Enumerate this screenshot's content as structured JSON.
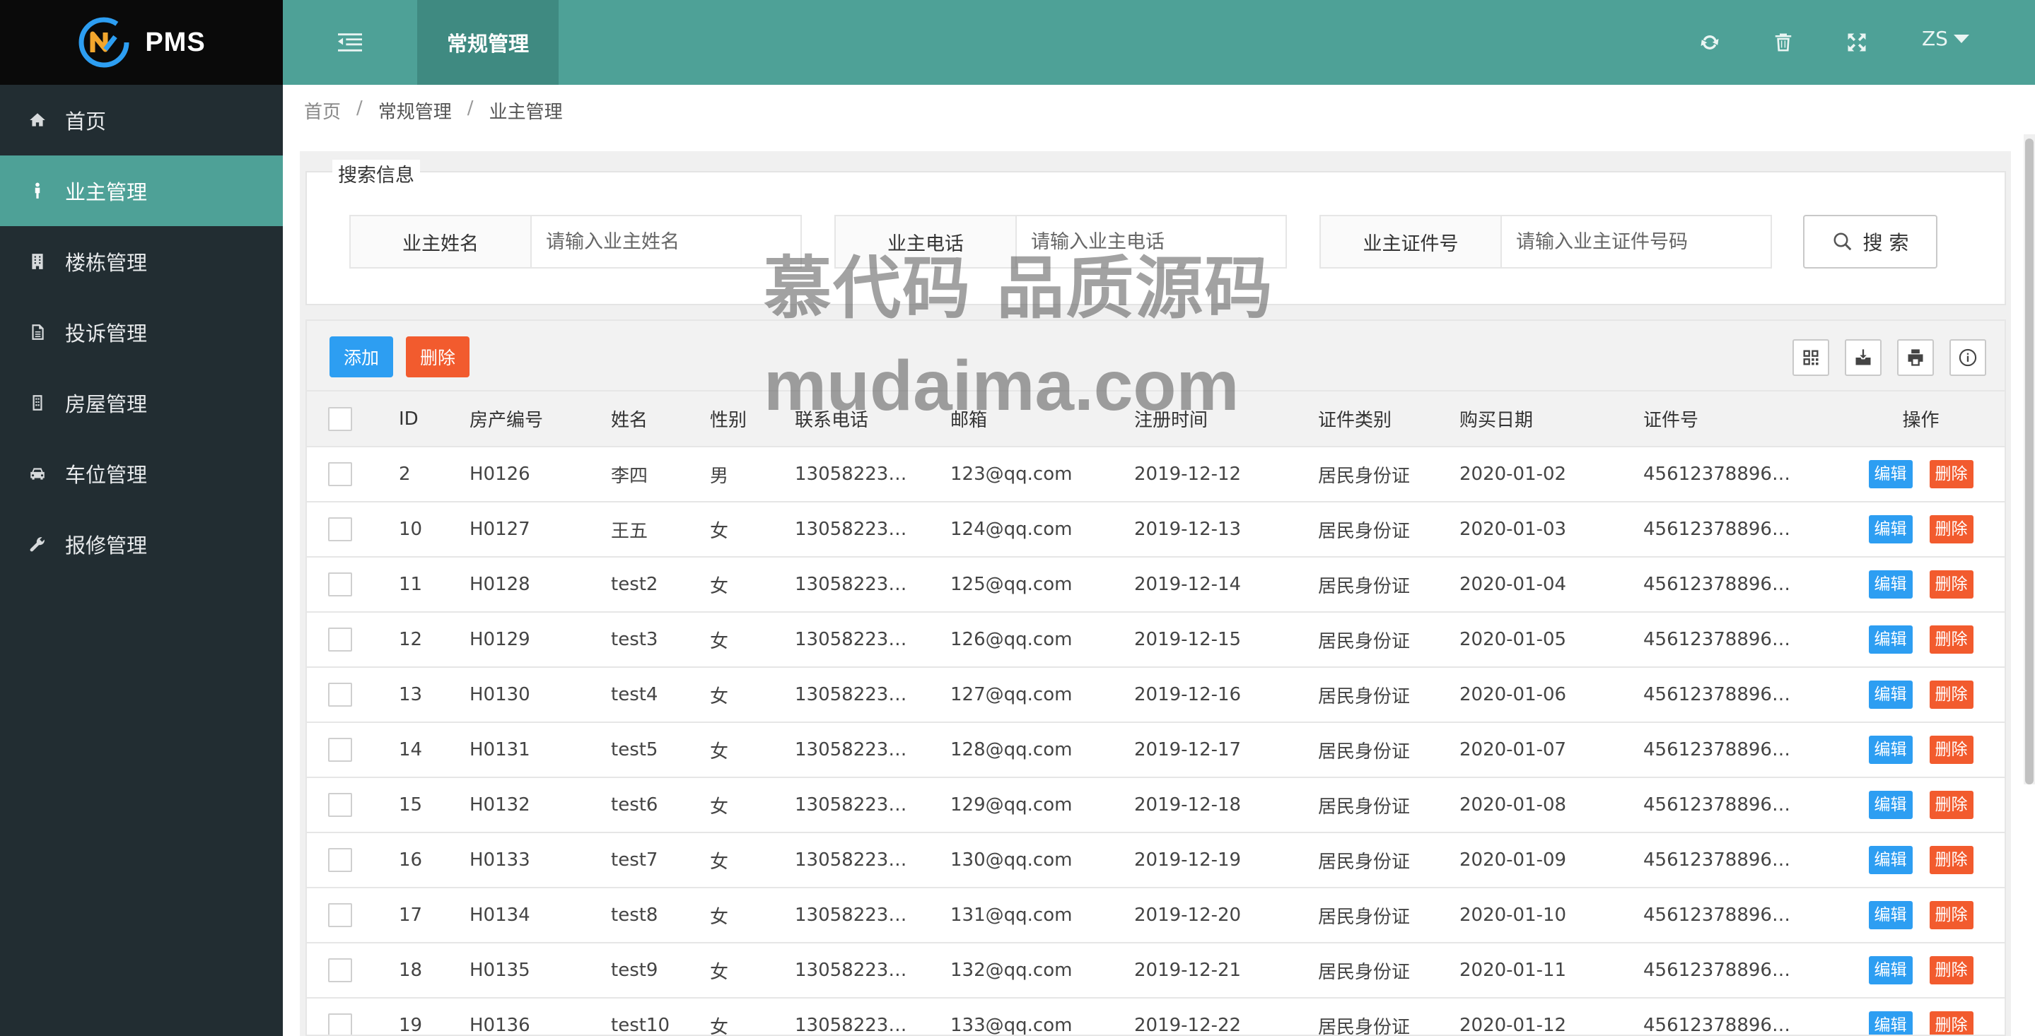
{
  "brand": {
    "name": "PMS"
  },
  "sidebar": {
    "items": [
      {
        "label": "首页",
        "icon": "home-icon"
      },
      {
        "label": "业主管理",
        "icon": "person-icon",
        "active": true
      },
      {
        "label": "楼栋管理",
        "icon": "building-icon"
      },
      {
        "label": "投诉管理",
        "icon": "document-icon"
      },
      {
        "label": "房屋管理",
        "icon": "house-icon"
      },
      {
        "label": "车位管理",
        "icon": "car-icon"
      },
      {
        "label": "报修管理",
        "icon": "wrench-icon"
      }
    ]
  },
  "header": {
    "tab": "常规管理",
    "user": "ZS",
    "icons": [
      "refresh-icon",
      "trash-icon",
      "fullscreen-icon",
      "more-icon"
    ]
  },
  "breadcrumb": {
    "home": "首页",
    "section": "常规管理",
    "page": "业主管理"
  },
  "search": {
    "legend": "搜索信息",
    "fields": [
      {
        "label": "业主姓名",
        "placeholder": "请输入业主姓名"
      },
      {
        "label": "业主电话",
        "placeholder": "请输入业主电话"
      },
      {
        "label": "业主证件号",
        "placeholder": "请输入业主证件号码"
      }
    ],
    "button": "搜 索"
  },
  "toolbar": {
    "add": "添加",
    "delete": "删除"
  },
  "table": {
    "columns": [
      "ID",
      "房产编号",
      "姓名",
      "性别",
      "联系电话",
      "邮箱",
      "注册时间",
      "证件类别",
      "购买日期",
      "证件号",
      "操作"
    ],
    "edit_label": "编辑",
    "delete_label": "删除",
    "rows": [
      {
        "id": "2",
        "house": "H0126",
        "name": "李四",
        "gender": "男",
        "phone": "13058223…",
        "email": "123@qq.com",
        "reg": "2019-12-12",
        "idtype": "居民身份证",
        "buy": "2020-01-02",
        "idno": "45612378896…"
      },
      {
        "id": "10",
        "house": "H0127",
        "name": "王五",
        "gender": "女",
        "phone": "13058223…",
        "email": "124@qq.com",
        "reg": "2019-12-13",
        "idtype": "居民身份证",
        "buy": "2020-01-03",
        "idno": "45612378896…"
      },
      {
        "id": "11",
        "house": "H0128",
        "name": "test2",
        "gender": "女",
        "phone": "13058223…",
        "email": "125@qq.com",
        "reg": "2019-12-14",
        "idtype": "居民身份证",
        "buy": "2020-01-04",
        "idno": "45612378896…"
      },
      {
        "id": "12",
        "house": "H0129",
        "name": "test3",
        "gender": "女",
        "phone": "13058223…",
        "email": "126@qq.com",
        "reg": "2019-12-15",
        "idtype": "居民身份证",
        "buy": "2020-01-05",
        "idno": "45612378896…"
      },
      {
        "id": "13",
        "house": "H0130",
        "name": "test4",
        "gender": "女",
        "phone": "13058223…",
        "email": "127@qq.com",
        "reg": "2019-12-16",
        "idtype": "居民身份证",
        "buy": "2020-01-06",
        "idno": "45612378896…"
      },
      {
        "id": "14",
        "house": "H0131",
        "name": "test5",
        "gender": "女",
        "phone": "13058223…",
        "email": "128@qq.com",
        "reg": "2019-12-17",
        "idtype": "居民身份证",
        "buy": "2020-01-07",
        "idno": "45612378896…"
      },
      {
        "id": "15",
        "house": "H0132",
        "name": "test6",
        "gender": "女",
        "phone": "13058223…",
        "email": "129@qq.com",
        "reg": "2019-12-18",
        "idtype": "居民身份证",
        "buy": "2020-01-08",
        "idno": "45612378896…"
      },
      {
        "id": "16",
        "house": "H0133",
        "name": "test7",
        "gender": "女",
        "phone": "13058223…",
        "email": "130@qq.com",
        "reg": "2019-12-19",
        "idtype": "居民身份证",
        "buy": "2020-01-09",
        "idno": "45612378896…"
      },
      {
        "id": "17",
        "house": "H0134",
        "name": "test8",
        "gender": "女",
        "phone": "13058223…",
        "email": "131@qq.com",
        "reg": "2019-12-20",
        "idtype": "居民身份证",
        "buy": "2020-01-10",
        "idno": "45612378896…"
      },
      {
        "id": "18",
        "house": "H0135",
        "name": "test9",
        "gender": "女",
        "phone": "13058223…",
        "email": "132@qq.com",
        "reg": "2019-12-21",
        "idtype": "居民身份证",
        "buy": "2020-01-11",
        "idno": "45612378896…"
      },
      {
        "id": "19",
        "house": "H0136",
        "name": "test10",
        "gender": "女",
        "phone": "13058223…",
        "email": "133@qq.com",
        "reg": "2019-12-22",
        "idtype": "居民身份证",
        "buy": "2020-01-12",
        "idno": "45612378896…"
      }
    ]
  },
  "watermark": {
    "line1": "慕代码 品质源码",
    "line2": "mudaima.com"
  },
  "colors": {
    "teal": "#4ea197",
    "teal_dark": "#3f8a81",
    "sidebar": "#222d32",
    "primary": "#2d9ef2",
    "danger": "#f25b2e"
  }
}
